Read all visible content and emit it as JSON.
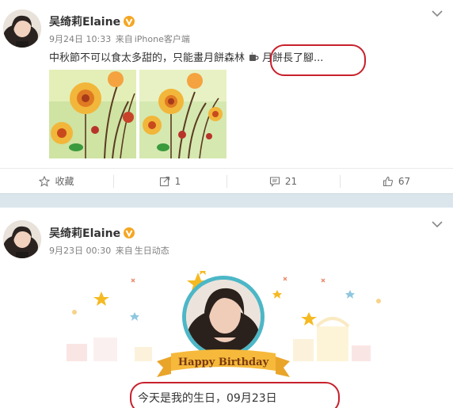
{
  "posts": [
    {
      "username": "吴绮莉Elaine",
      "date": "9月24日 10:33",
      "source_prefix": "来自",
      "source": "iPhone客户端",
      "text_before": "中秋節不可以食太多甜的，只能畫月餅森林",
      "text_after": "月餅長了腳...",
      "actions": {
        "favorite_label": "收藏",
        "repost_count": "1",
        "comment_count": "21",
        "like_count": "67"
      }
    },
    {
      "username": "吴绮莉Elaine",
      "date": "9月23日 00:30",
      "source_prefix": "来自",
      "source": "生日动态",
      "banner_text": "Happy Birthday",
      "text": "今天是我的生日，09月23日"
    }
  ],
  "colors": {
    "highlight": "#c8202c",
    "verified_badge": "#f5a623",
    "banner": "#f6b93b",
    "separator": "#dbe6ec"
  },
  "icons": [
    "verified-badge-icon",
    "chevron-down-icon",
    "star-icon",
    "repost-icon",
    "comment-icon",
    "like-icon",
    "cup-emoji-icon"
  ]
}
